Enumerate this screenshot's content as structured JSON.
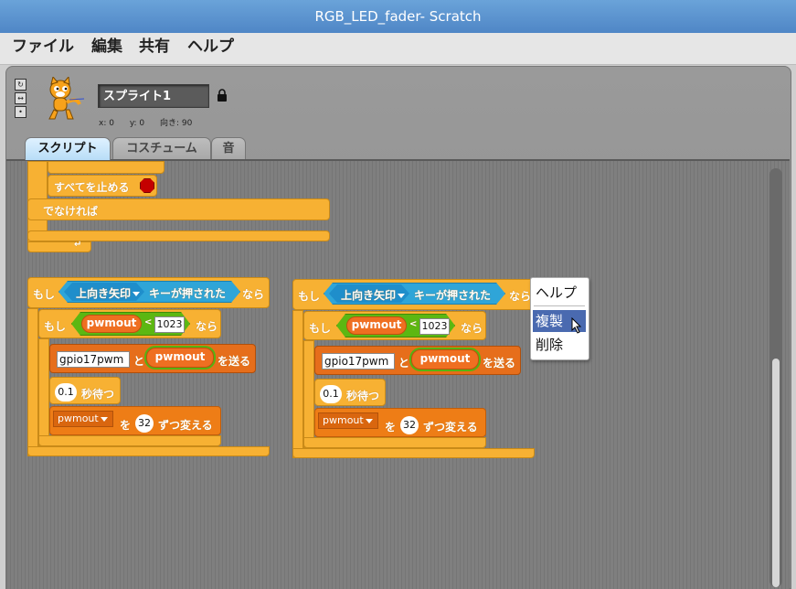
{
  "window": {
    "title": "RGB_LED_fader- Scratch"
  },
  "menu": {
    "file": "ファイル",
    "edit": "編集",
    "share": "共有",
    "help": "ヘルプ"
  },
  "sprite": {
    "name": "スプライト1",
    "x_label": "x: 0",
    "y_label": "y: 0",
    "direction_label": "向き: 90"
  },
  "tabs": [
    {
      "label": "スクリプト"
    },
    {
      "label": "コスチューム"
    },
    {
      "label": "音"
    }
  ],
  "script1": {
    "stop_all": "すべてを止める",
    "else": "でなければ"
  },
  "script2": {
    "if": "もし",
    "key": "上向き矢印",
    "key_pressed": "キーが押された",
    "then": "なら",
    "inner_if": "もし",
    "var": "pwmout",
    "lt": "<",
    "limit": "1023",
    "inner_then": "なら",
    "bus": "gpio17pwm",
    "and": "と",
    "send": "を送る",
    "wait_val": "0.1",
    "wait": "秒待つ",
    "change_var": "pwmout",
    "change_by_to": "を",
    "change_val": "32",
    "change_suffix": "ずつ変える"
  },
  "script3": {
    "if": "もし",
    "key": "上向き矢印",
    "key_pressed": "キーが押された",
    "then": "なら",
    "inner_if": "もし",
    "var": "pwmout",
    "lt": "<",
    "limit": "1023",
    "inner_then": "なら",
    "bus": "gpio17pwm",
    "and": "と",
    "send": "を送る",
    "wait_val": "0.1",
    "wait": "秒待つ",
    "change_var": "pwmout",
    "change_by_to": "を",
    "change_val": "32",
    "change_suffix": "ずつ変える"
  },
  "context_menu": {
    "items": [
      {
        "label": "ヘルプ"
      },
      {
        "label": "複製"
      },
      {
        "label": "削除"
      }
    ],
    "highlighted": "複製"
  },
  "colors": {
    "control": "#f7b133",
    "sensing": "#2fa5d8",
    "operator": "#5cb712",
    "variable": "#ee7d16",
    "title_bar": "#4f86c6"
  }
}
